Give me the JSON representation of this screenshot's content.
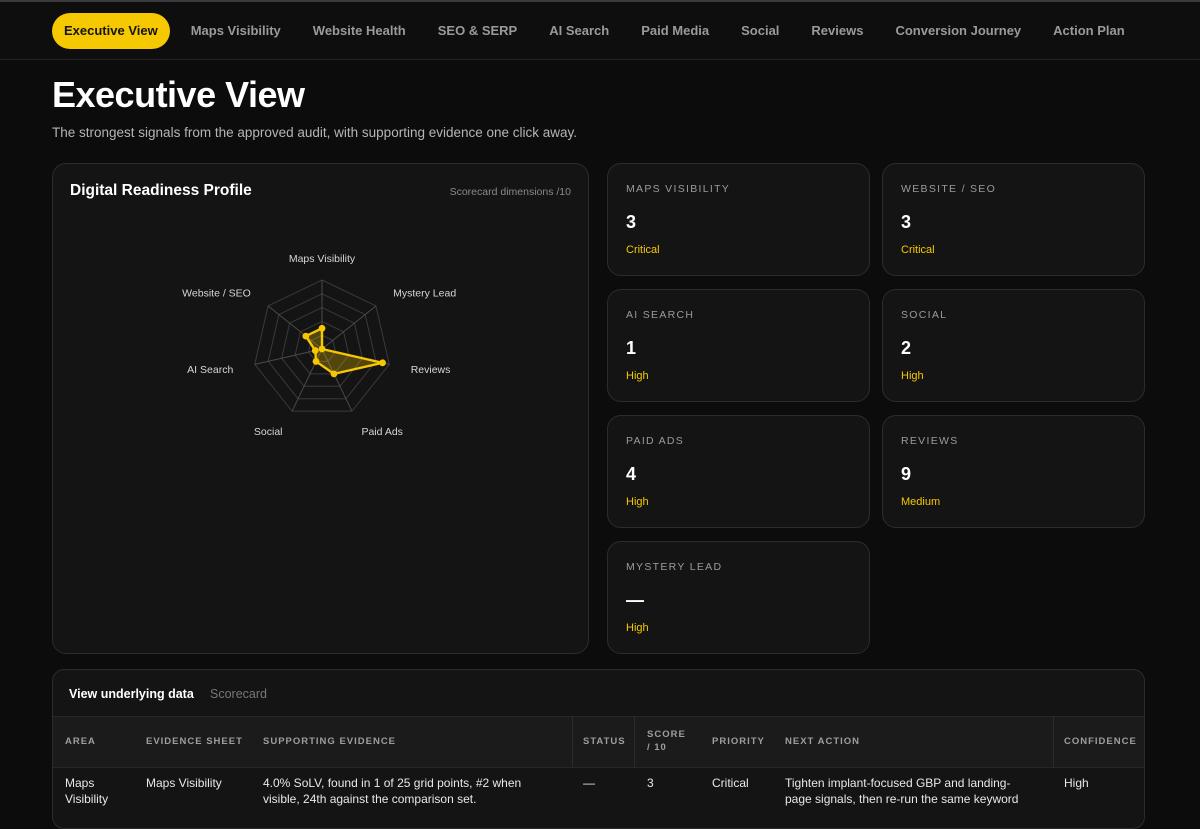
{
  "nav": {
    "tabs": [
      "Executive View",
      "Maps Visibility",
      "Website Health",
      "SEO & SERP",
      "AI Search",
      "Paid Media",
      "Social",
      "Reviews",
      "Conversion Journey",
      "Action Plan"
    ]
  },
  "page": {
    "title": "Executive View",
    "subtitle": "The strongest signals from the approved audit, with supporting evidence one click away."
  },
  "profile": {
    "title": "Digital Readiness Profile",
    "note": "Scorecard dimensions /10"
  },
  "chart_data": {
    "type": "radar",
    "title": "Digital Readiness Profile",
    "subtitle": "Scorecard dimensions /10",
    "axes": [
      "Maps Visibility",
      "Mystery Lead",
      "Reviews",
      "Paid Ads",
      "Social",
      "AI Search",
      "Website / SEO"
    ],
    "range": [
      0,
      10
    ],
    "series": [
      {
        "values": [
          3,
          0,
          9,
          4,
          2,
          1,
          3
        ]
      }
    ],
    "colors": {
      "series": "#f5c800",
      "grid": "#3a3a3a"
    }
  },
  "metrics": [
    {
      "label": "MAPS VISIBILITY",
      "value": "3",
      "level": "Critical"
    },
    {
      "label": "WEBSITE / SEO",
      "value": "3",
      "level": "Critical"
    },
    {
      "label": "AI SEARCH",
      "value": "1",
      "level": "High"
    },
    {
      "label": "SOCIAL",
      "value": "2",
      "level": "High"
    },
    {
      "label": "PAID ADS",
      "value": "4",
      "level": "High"
    },
    {
      "label": "REVIEWS",
      "value": "9",
      "level": "Medium"
    },
    {
      "label": "MYSTERY LEAD",
      "value": "—",
      "level": "High"
    }
  ],
  "data_panel": {
    "heading": "View underlying data",
    "sub": "Scorecard",
    "columns": [
      "AREA",
      "EVIDENCE SHEET",
      "SUPPORTING EVIDENCE",
      "STATUS",
      "SCORE",
      "/ 10",
      "PRIORITY",
      "NEXT ACTION",
      "CONFIDENCE"
    ],
    "row": {
      "area_1": "Maps",
      "area_2": "Visibility",
      "sheet": "Maps Visibility",
      "evidence_1": "4.0% SoLV, found in 1 of 25 grid points, #2 when",
      "evidence_2": "visible, 24th against the comparison set.",
      "status": "—",
      "score": "3",
      "priority": "Critical",
      "action_1": "Tighten implant-focused GBP and landing-",
      "action_2": "page signals, then re-run the same keyword",
      "confidence": "High"
    }
  },
  "colors": {
    "accent": "#f5c800",
    "background": "#0c0c0c",
    "card": "#141414"
  }
}
